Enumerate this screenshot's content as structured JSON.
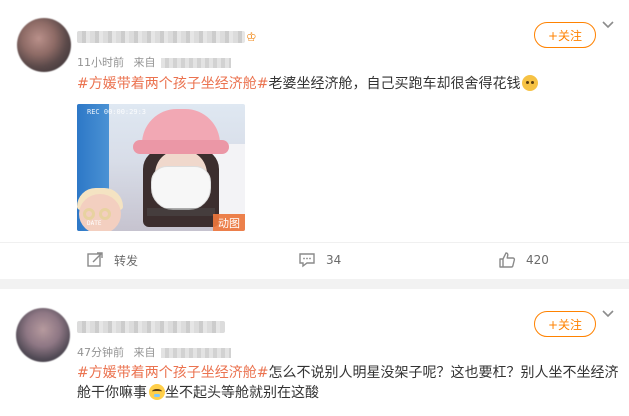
{
  "post1": {
    "time": "11小时前",
    "source_prefix": "来自",
    "follow_label": "+关注",
    "hashtag": "#方媛带着两个孩子坐经济舱#",
    "text": "老婆坐经济舱，自己买跑车却很舍得花钱",
    "media": {
      "rec_overlay": "REC 00:00:29:3",
      "date_overlay": "DATE",
      "gif_badge": "动图"
    },
    "actions": {
      "repost_label": "转发",
      "comment_count": "34",
      "like_count": "420"
    }
  },
  "post2": {
    "time": "47分钟前",
    "source_prefix": "来自",
    "follow_label": "+关注",
    "hashtag": "#方媛带着两个孩子坐经济舱#",
    "text_part1": "怎么不说别人明星没架子呢？这也要杠？别人坐不坐经济舱干你嘛事",
    "text_part2": "坐不起头等舱就别在这酸"
  },
  "colors": {
    "accent": "#ff8200",
    "hashtag": "#eb7350",
    "meta": "#939393"
  },
  "icons": {
    "chevron": "chevron-down-icon",
    "repost": "repost-icon",
    "comment": "comment-icon",
    "like": "like-icon"
  }
}
